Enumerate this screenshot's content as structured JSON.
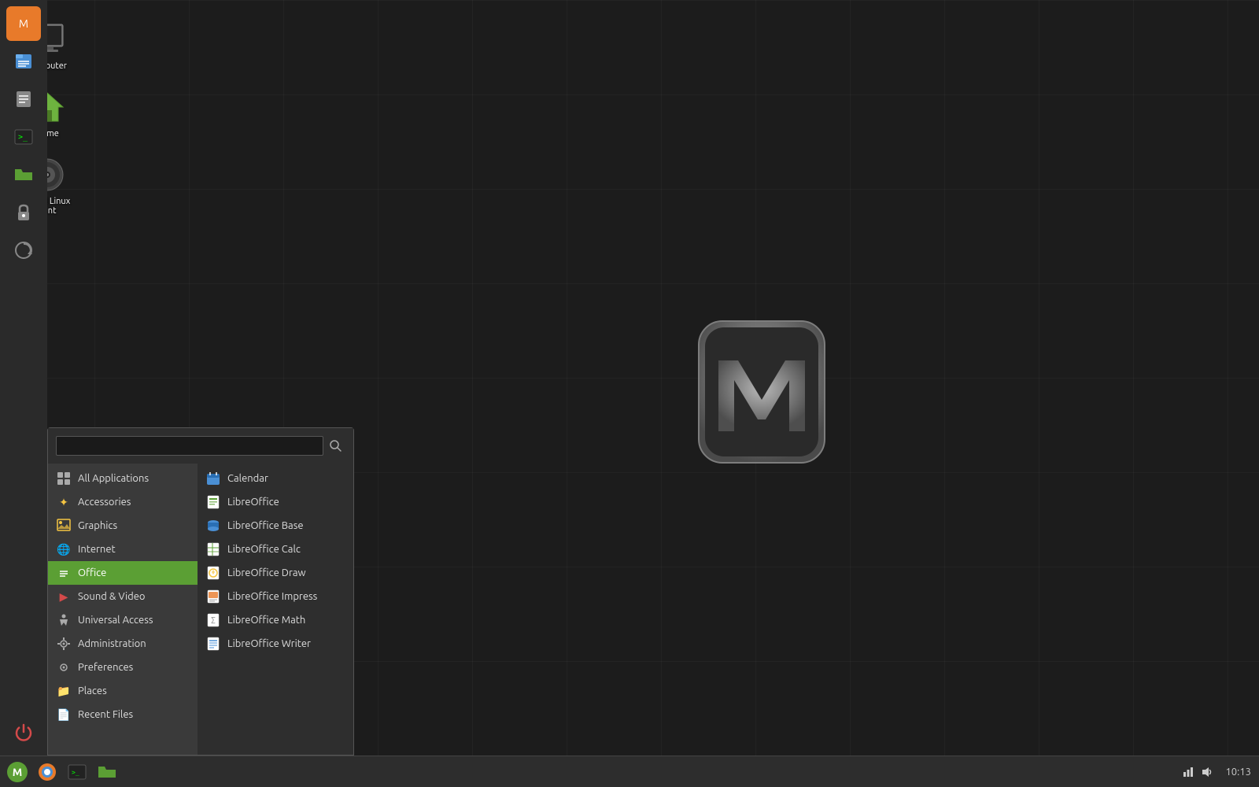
{
  "desktop": {
    "icons": [
      {
        "id": "computer",
        "label": "Computer",
        "type": "computer"
      },
      {
        "id": "home",
        "label": "Home",
        "type": "home"
      },
      {
        "id": "install",
        "label": "Install Linux Mint",
        "type": "dvd"
      }
    ]
  },
  "sidebar": {
    "buttons": [
      {
        "id": "mintmenu",
        "icon": "🌿",
        "color": "#e87a2a",
        "label": "mintmenu"
      },
      {
        "id": "files",
        "icon": "📋",
        "color": "#4a8fd4",
        "label": "files"
      },
      {
        "id": "notes",
        "icon": "📝",
        "color": "#888",
        "label": "notes"
      },
      {
        "id": "terminal",
        "icon": "⬛",
        "color": "#333",
        "label": "terminal"
      },
      {
        "id": "folder",
        "icon": "📁",
        "color": "#5b9f34",
        "label": "folder"
      },
      {
        "id": "lock",
        "icon": "🔒",
        "color": "#888",
        "label": "lock"
      },
      {
        "id": "update",
        "icon": "🔄",
        "color": "#888",
        "label": "update"
      },
      {
        "id": "power",
        "icon": "⏻",
        "color": "#d44a4a",
        "label": "power"
      }
    ]
  },
  "app_menu": {
    "search_placeholder": "",
    "categories": [
      {
        "id": "all",
        "label": "All Applications",
        "icon": "⊞",
        "active": false
      },
      {
        "id": "accessories",
        "label": "Accessories",
        "icon": "⚙",
        "color": "#aaa"
      },
      {
        "id": "graphics",
        "label": "Graphics",
        "icon": "🖼",
        "color": "#f5c542"
      },
      {
        "id": "internet",
        "label": "Internet",
        "icon": "🌐",
        "color": "#4a8fd4"
      },
      {
        "id": "office",
        "label": "Office",
        "icon": "📄",
        "color": "#5b9f34",
        "active": true
      },
      {
        "id": "sound-video",
        "label": "Sound & Video",
        "icon": "▶",
        "color": "#d44a4a"
      },
      {
        "id": "universal-access",
        "label": "Universal Access",
        "icon": "♿",
        "color": "#aaa"
      },
      {
        "id": "administration",
        "label": "Administration",
        "icon": "⚙",
        "color": "#aaa"
      },
      {
        "id": "preferences",
        "label": "Preferences",
        "icon": "⚙",
        "color": "#aaa"
      },
      {
        "id": "places",
        "label": "Places",
        "icon": "📁",
        "color": "#5b9f34"
      },
      {
        "id": "recent-files",
        "label": "Recent Files",
        "icon": "📄",
        "color": "#aaa"
      }
    ],
    "apps": [
      {
        "id": "calendar",
        "label": "Calendar",
        "icon": "📅",
        "color": "#4a8fd4"
      },
      {
        "id": "libreoffice",
        "label": "LibreOffice",
        "icon": "📄",
        "color": "#5b9f34"
      },
      {
        "id": "libreoffice-base",
        "label": "LibreOffice Base",
        "icon": "🗄",
        "color": "#4a8fd4"
      },
      {
        "id": "libreoffice-calc",
        "label": "LibreOffice Calc",
        "icon": "📊",
        "color": "#5b9f34"
      },
      {
        "id": "libreoffice-draw",
        "label": "LibreOffice Draw",
        "icon": "✏",
        "color": "#f5c542"
      },
      {
        "id": "libreoffice-impress",
        "label": "LibreOffice Impress",
        "icon": "📽",
        "color": "#e87a2a"
      },
      {
        "id": "libreoffice-math",
        "label": "LibreOffice Math",
        "icon": "∑",
        "color": "#aaa"
      },
      {
        "id": "libreoffice-writer",
        "label": "LibreOffice Writer",
        "icon": "✍",
        "color": "#4a8fd4"
      }
    ],
    "footer": [
      {
        "id": "places",
        "label": "Places",
        "icon": "📁"
      },
      {
        "id": "recent",
        "label": "Recent Files",
        "icon": "📄"
      }
    ]
  },
  "taskbar": {
    "time": "10:13",
    "items": [
      {
        "id": "mint-start",
        "icon": "mint"
      },
      {
        "id": "firefox",
        "icon": "🦊"
      },
      {
        "id": "terminal",
        "icon": "⬛"
      },
      {
        "id": "folder",
        "icon": "📁"
      }
    ]
  }
}
